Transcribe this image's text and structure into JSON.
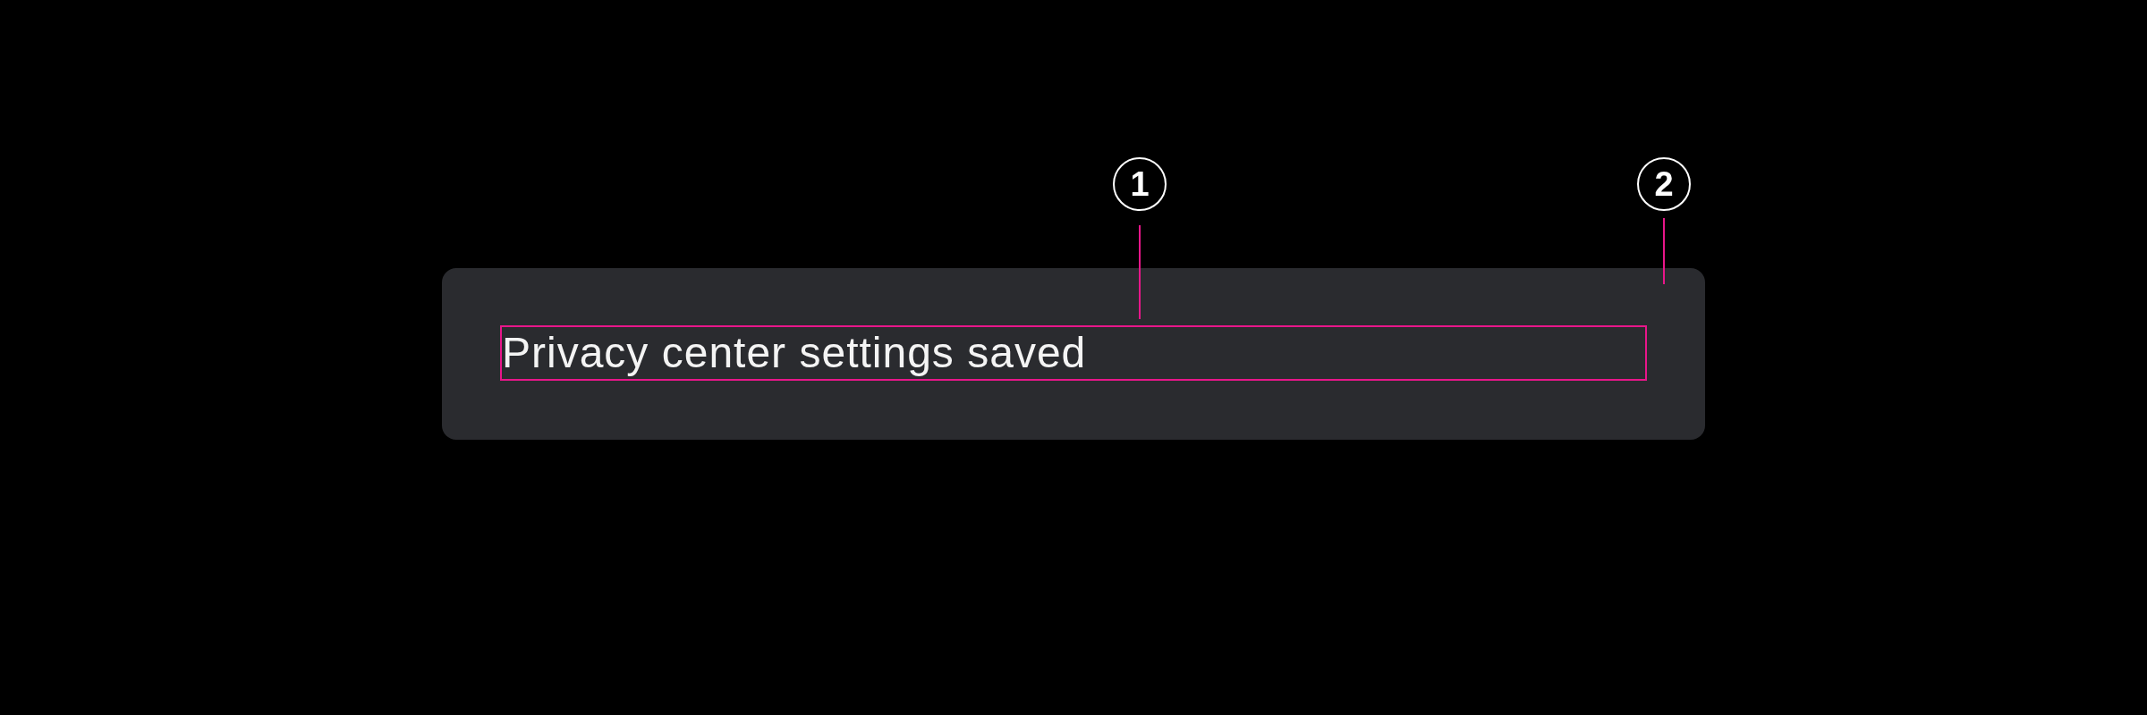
{
  "snackbar": {
    "message": "Privacy center settings saved"
  },
  "annotations": [
    {
      "number": "1",
      "kind": "label"
    },
    {
      "number": "2",
      "kind": "container"
    }
  ]
}
